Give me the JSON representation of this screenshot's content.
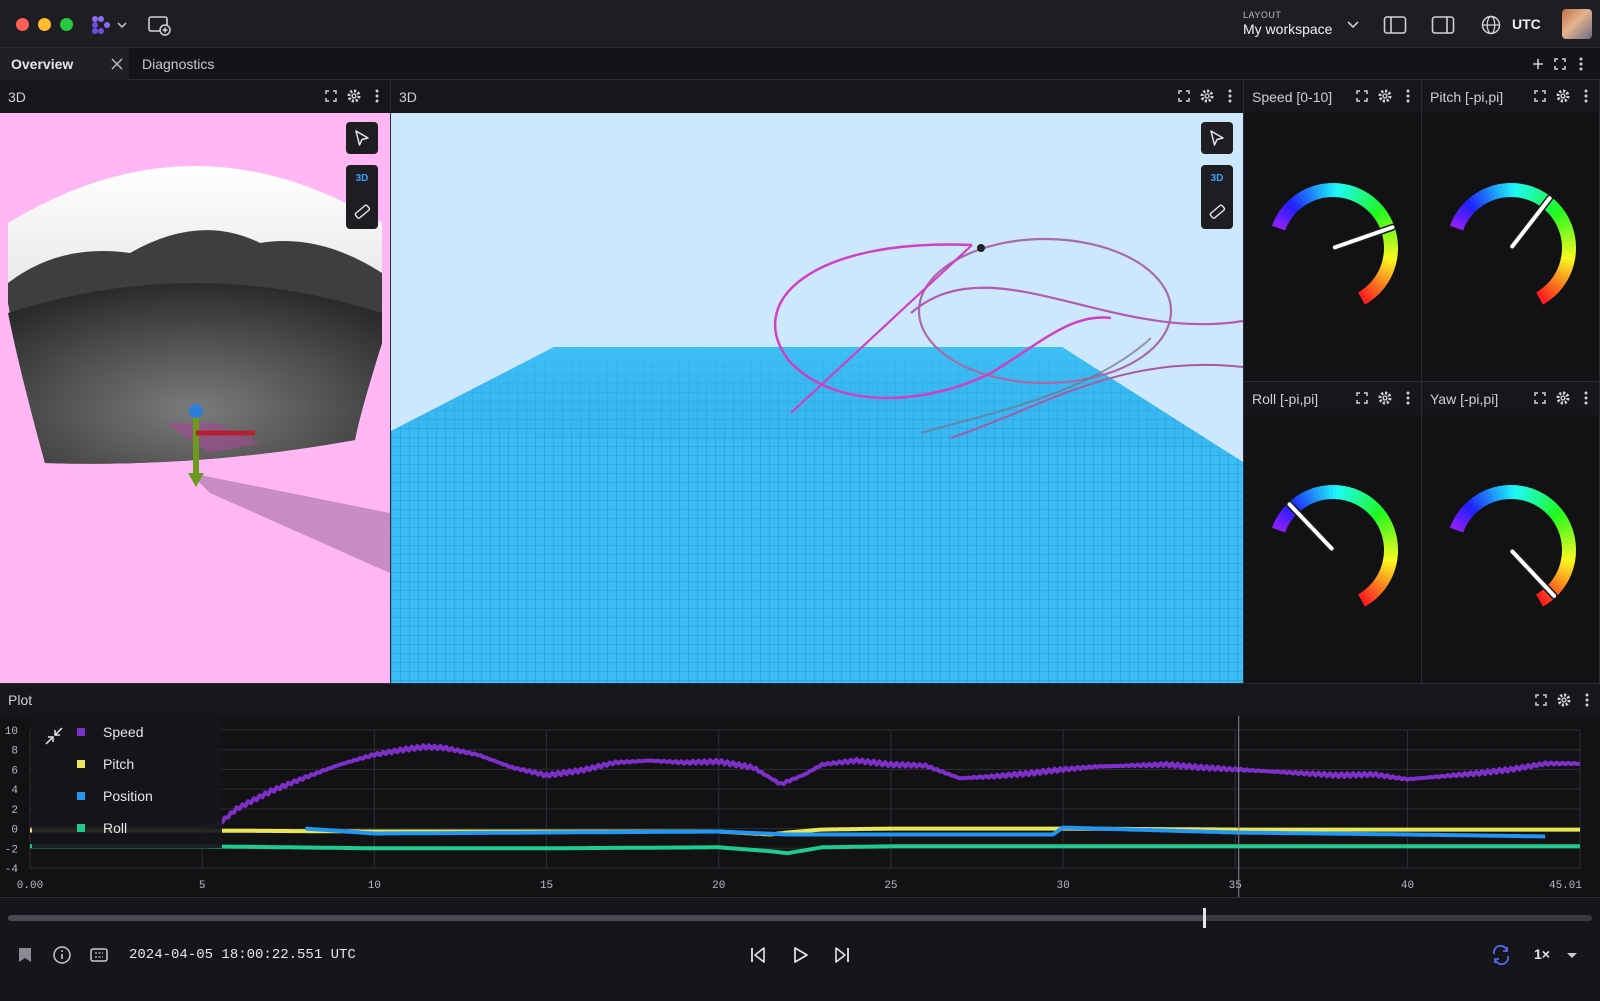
{
  "app": {
    "layout_label": "LAYOUT",
    "layout_name": "My workspace",
    "timezone_label": "UTC"
  },
  "tabs": [
    {
      "label": "Overview",
      "active": true
    },
    {
      "label": "Diagnostics",
      "active": false
    }
  ],
  "panels": {
    "left3d": {
      "title": "3D",
      "mode_label": "3D"
    },
    "main3d": {
      "title": "3D",
      "mode_label": "3D"
    },
    "gauges": [
      {
        "title": "Speed [0-10]",
        "value_fraction": 0.64
      },
      {
        "title": "Pitch [-pi,pi]",
        "value_fraction": 0.49
      },
      {
        "title": "Roll [-pi,pi]",
        "value_fraction": 0.12
      },
      {
        "title": "Yaw [-pi,pi]",
        "value_fraction": 0.94
      }
    ],
    "plot": {
      "title": "Plot"
    }
  },
  "chart_data": {
    "type": "line",
    "xlim": [
      0,
      45.01
    ],
    "ylim": [
      -4,
      10
    ],
    "x_ticks": [
      "0.00",
      "5",
      "10",
      "15",
      "20",
      "25",
      "30",
      "35",
      "40",
      "45.01"
    ],
    "y_ticks": [
      "10",
      "8",
      "6",
      "4",
      "2",
      "0",
      "-2",
      "-4"
    ],
    "cursor_x": 35.1,
    "legend_placement": "top-left",
    "series": [
      {
        "name": "Speed",
        "color": "#7e2fc9",
        "x": [
          0,
          1.2,
          2,
          3,
          4,
          5,
          5.5,
          6,
          7,
          8,
          9,
          10,
          11,
          11.5,
          12,
          13,
          14,
          15,
          16,
          17,
          18,
          19,
          20,
          21,
          21.8,
          22.5,
          23,
          24,
          25,
          26,
          27,
          28,
          29,
          30,
          31,
          32,
          33,
          34,
          35,
          36,
          37,
          38,
          39,
          40,
          41,
          42,
          43,
          44,
          45.01
        ],
        "y": [
          0,
          0,
          0,
          0,
          0,
          0,
          0.5,
          2,
          3.8,
          5.2,
          6.5,
          7.5,
          8.1,
          8.3,
          8.2,
          7.5,
          6.2,
          5.4,
          5.9,
          6.7,
          6.9,
          6.7,
          6.8,
          6.2,
          4.5,
          5.5,
          6.5,
          6.9,
          6.5,
          6.4,
          5.1,
          5.3,
          5.6,
          6.0,
          6.3,
          6.4,
          6.5,
          6.2,
          6.0,
          5.8,
          5.6,
          5.4,
          5.5,
          5.0,
          5.3,
          5.6,
          6.0,
          6.6,
          6.6
        ]
      },
      {
        "name": "Pitch",
        "color": "#e8e857",
        "x": [
          0,
          5,
          10,
          15,
          20,
          21.5,
          22,
          23,
          25,
          30,
          35,
          40,
          45.01
        ],
        "y": [
          -0.2,
          -0.2,
          -0.3,
          -0.3,
          -0.3,
          -0.6,
          -0.4,
          -0.1,
          0.0,
          0.0,
          -0.1,
          -0.1,
          -0.1
        ]
      },
      {
        "name": "Position",
        "color": "#2196f3",
        "x": [
          8,
          10,
          15,
          20,
          22,
          25,
          29.7,
          30,
          35,
          40,
          44
        ],
        "y": [
          0,
          -0.5,
          -0.4,
          -0.3,
          -0.6,
          -0.6,
          -0.6,
          0.1,
          -0.4,
          -0.6,
          -0.8
        ]
      },
      {
        "name": "Roll",
        "color": "#1ecb8c",
        "x": [
          0,
          5,
          10,
          15,
          20,
          21.5,
          22,
          23,
          25,
          30,
          35,
          40,
          45.01
        ],
        "y": [
          -1.8,
          -1.8,
          -2.0,
          -2.0,
          -1.9,
          -2.3,
          -2.5,
          -1.9,
          -1.8,
          -1.8,
          -1.8,
          -1.8,
          -1.8
        ]
      }
    ]
  },
  "playback": {
    "timestamp": "2024-04-05 18:00:22.551 UTC",
    "speed": "1×",
    "progress_fraction": 0.755
  }
}
